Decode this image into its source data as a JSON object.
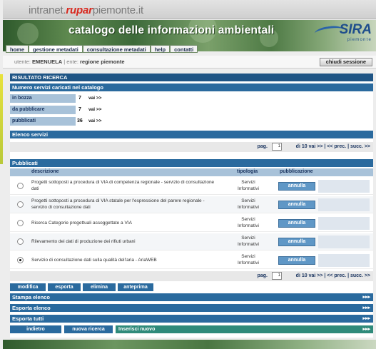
{
  "header": {
    "logo_pre": "intranet.",
    "logo_brand": "rupar",
    "logo_post": "piemonte.it",
    "banner_title": "catalogo delle informazioni ambientali",
    "sira_logo": "SIRA",
    "sira_sub": "piemonte",
    "tabs": [
      "home",
      "gestione metadati",
      "consultazione metadati",
      "help",
      "contatti"
    ]
  },
  "userline": {
    "utente_label": "utente:",
    "utente_value": "EMENUELA",
    "ente_label": " | ente:",
    "ente_value": "regione piemonte",
    "close_label": "chiudi sessione"
  },
  "results": {
    "title": "RISULTATO RICERCA",
    "subtitle": "Numero servizi caricati nel catalogo",
    "rows": [
      {
        "label": "in bozza",
        "count": "7",
        "link": "vai >>"
      },
      {
        "label": "da pubblicare",
        "count": "7",
        "link": "vai >>"
      },
      {
        "label": "pubblicati",
        "count": "36",
        "link": "vai >>"
      }
    ]
  },
  "elenco": {
    "title": "Elenco servizi",
    "pag_label": "pag.",
    "pag_value": "1",
    "pag_rest": "di 10  vai >>  |  << prec.  |  succ. >>"
  },
  "pubblicati": {
    "title": "Pubblicati",
    "columns": [
      "descrizione",
      "tipologia",
      "pubblicazione"
    ],
    "rows": [
      {
        "desc": "Progetti sottoposti a procedura di VIA di competenza regionale - servizio di consultazione dati",
        "tipologia": "Servizi Informativi",
        "action": "annulla",
        "selected": false
      },
      {
        "desc": "Progetti sottoposti a procedura di VIA statale per l'espressione del parere regionale - servizio di consultazione dati",
        "tipologia": "Servizi Informativi",
        "action": "annulla",
        "selected": false
      },
      {
        "desc": "Ricerca Categorie progettuali assoggettate a VIA",
        "tipologia": "Servizi Informativi",
        "action": "annulla",
        "selected": false
      },
      {
        "desc": "Rilevamento dei dati di produzione dei rifiuti urbani",
        "tipologia": "Servizi Informativi",
        "action": "annulla",
        "selected": false
      },
      {
        "desc": "Servizio di consultazione dati sulla qualità dell'aria - AriaWEB",
        "tipologia": "Servizi Informativi",
        "action": "annulla",
        "selected": true
      }
    ]
  },
  "actions": [
    "modifica",
    "esporta",
    "elimina",
    "anteprima"
  ],
  "sections": [
    {
      "label": "Stampa elenco",
      "arrows": "▸▸▸"
    },
    {
      "label": "Esporta elenco",
      "arrows": "▸▸▸"
    },
    {
      "label": "Esporta tutti",
      "arrows": "▸▸▸"
    }
  ],
  "bottom": {
    "indietro": "indietro",
    "nuova": "nuova ricerca",
    "inserisci": "Inserisci nuovo",
    "arrows": "▸▸▸"
  }
}
